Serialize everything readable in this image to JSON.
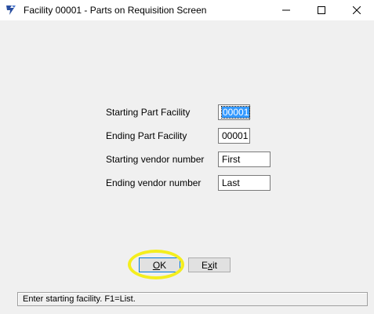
{
  "window": {
    "title": "Facility 00001 - Parts on Requisition Screen",
    "icon": "app-logo-icon",
    "controls": {
      "minimize": "minimize-icon",
      "maximize": "maximize-icon",
      "close": "close-icon"
    }
  },
  "form": {
    "starting_part_facility": {
      "label": "Starting Part Facility",
      "value": "00001"
    },
    "ending_part_facility": {
      "label": "Ending Part Facility",
      "value": "00001"
    },
    "starting_vendor_number": {
      "label": "Starting vendor number",
      "value": "First"
    },
    "ending_vendor_number": {
      "label": "Ending vendor number",
      "value": "Last"
    }
  },
  "buttons": {
    "ok": {
      "label_prefix": "",
      "label_mnemonic": "O",
      "label_rest": "K"
    },
    "exit": {
      "label_prefix": "E",
      "label_mnemonic": "x",
      "label_rest": "it"
    }
  },
  "status_bar": {
    "text": "Enter starting facility.  F1=List."
  },
  "colors": {
    "highlight_ring": "#f4ee1e",
    "selection": "#3399ff",
    "focus_border": "#0078d7"
  }
}
